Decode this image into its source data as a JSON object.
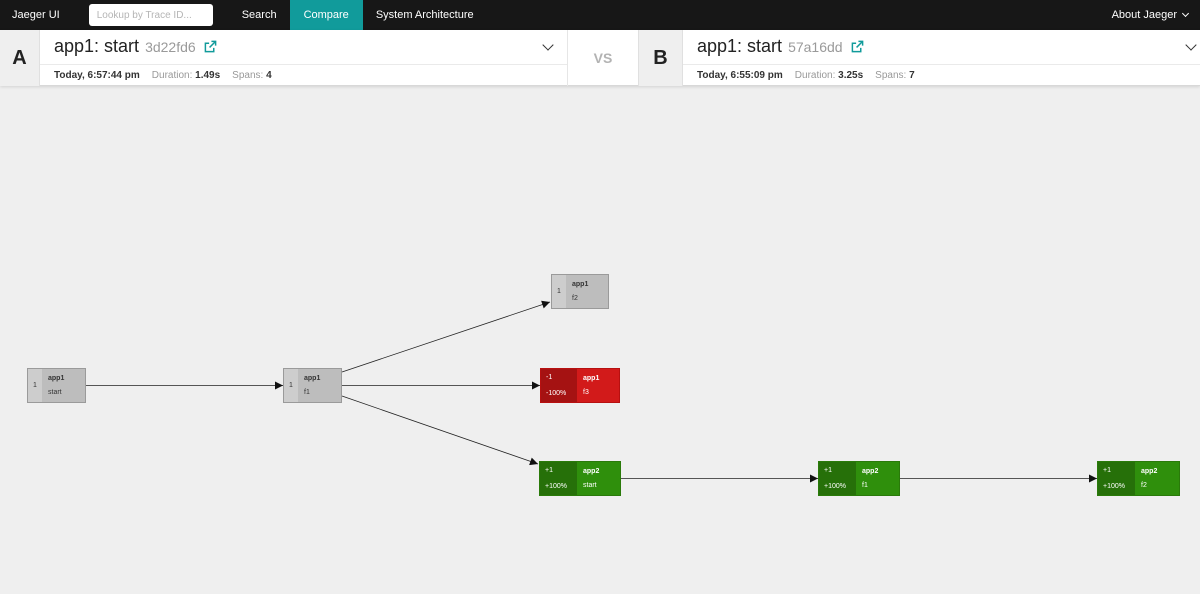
{
  "nav": {
    "brand": "Jaeger UI",
    "search_placeholder": "Lookup by Trace ID...",
    "links": [
      "Search",
      "Compare",
      "System Architecture"
    ],
    "about": "About Jaeger",
    "active_link": "Compare",
    "accent_color": "#119b9b"
  },
  "compare": {
    "a": {
      "letter": "A",
      "title": "app1: start",
      "trace_id": "3d22fd6",
      "time": "Today, 6:57:44 pm",
      "duration_label": "Duration:",
      "duration": "1.49s",
      "spans_label": "Spans:",
      "spans": "4"
    },
    "vs": "VS",
    "b": {
      "letter": "B",
      "title": "app1: start",
      "trace_id": "57a16dd",
      "time": "Today, 6:55:09 pm",
      "duration_label": "Duration:",
      "duration": "3.25s",
      "spans_label": "Spans:",
      "spans": "7"
    }
  },
  "graph": {
    "colors": {
      "same": "#bdbdbd",
      "removed": "#d21a1a",
      "added": "#2f8f0c"
    },
    "nodes": [
      {
        "id": "n1",
        "kind": "same",
        "count": "1",
        "pct": "",
        "service": "app1",
        "operation": "start"
      },
      {
        "id": "n2",
        "kind": "same",
        "count": "1",
        "pct": "",
        "service": "app1",
        "operation": "f1"
      },
      {
        "id": "n3",
        "kind": "same",
        "count": "1",
        "pct": "",
        "service": "app1",
        "operation": "f2"
      },
      {
        "id": "n4",
        "kind": "removed",
        "count": "-1",
        "pct": "-100%",
        "service": "app1",
        "operation": "f3"
      },
      {
        "id": "n5",
        "kind": "added",
        "count": "+1",
        "pct": "+100%",
        "service": "app2",
        "operation": "start"
      },
      {
        "id": "n6",
        "kind": "added",
        "count": "+1",
        "pct": "+100%",
        "service": "app2",
        "operation": "f1"
      },
      {
        "id": "n7",
        "kind": "added",
        "count": "+1",
        "pct": "+100%",
        "service": "app2",
        "operation": "f2"
      }
    ],
    "edges": [
      [
        "n1",
        "n2"
      ],
      [
        "n2",
        "n3"
      ],
      [
        "n2",
        "n4"
      ],
      [
        "n2",
        "n5"
      ],
      [
        "n5",
        "n6"
      ],
      [
        "n6",
        "n7"
      ]
    ]
  }
}
